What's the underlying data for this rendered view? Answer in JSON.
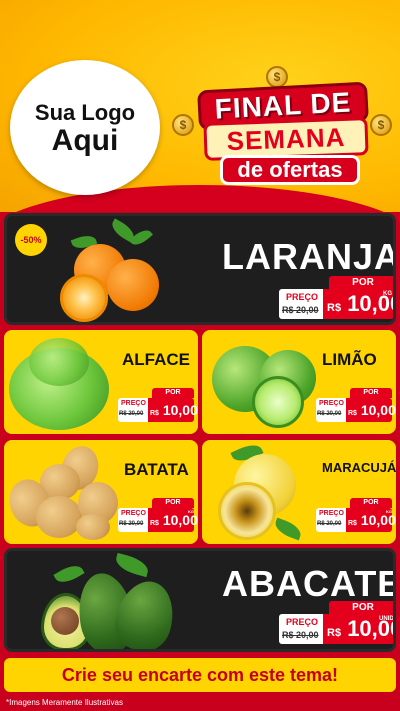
{
  "header": {
    "logo_line1": "Sua Logo",
    "logo_line2": "Aqui",
    "title_line1": "FINAL DE",
    "title_line2": "SEMANA",
    "title_line3": "de ofertas",
    "coin_symbol": "$"
  },
  "products": [
    {
      "name": "LARANJA",
      "discount_badge": "-50%",
      "por": "POR",
      "preco_label": "PREÇO",
      "old_price": "R$ 20,00",
      "currency": "R$",
      "new_price": "10,00",
      "unit": "KG"
    },
    {
      "name": "ALFACE",
      "por": "POR",
      "preco_label": "PREÇO",
      "old_price": "R$ 20,00",
      "currency": "R$",
      "new_price": "10,00",
      "unit": ""
    },
    {
      "name": "LIMÃO",
      "por": "POR",
      "preco_label": "PREÇO",
      "old_price": "R$ 20,00",
      "currency": "R$",
      "new_price": "10,00",
      "unit": ""
    },
    {
      "name": "BATATA",
      "por": "POR",
      "preco_label": "PREÇO",
      "old_price": "R$ 20,00",
      "currency": "R$",
      "new_price": "10,00",
      "unit": "KG"
    },
    {
      "name": "MARACUJÁ",
      "por": "POR",
      "preco_label": "PREÇO",
      "old_price": "R$ 20,00",
      "currency": "R$",
      "new_price": "10,00",
      "unit": "KG"
    },
    {
      "name": "ABACATE",
      "por": "POR",
      "preco_label": "PREÇO",
      "old_price": "R$ 20,00",
      "currency": "R$",
      "new_price": "10,00",
      "unit": "UNID"
    }
  ],
  "banner_text": "Crie seu encarte com este tema!",
  "footnote": "*Imagens Meramente Ilustrativas",
  "colors": {
    "red": "#e4001c",
    "yellow": "#ffd400",
    "dark": "#1e1e1e"
  }
}
